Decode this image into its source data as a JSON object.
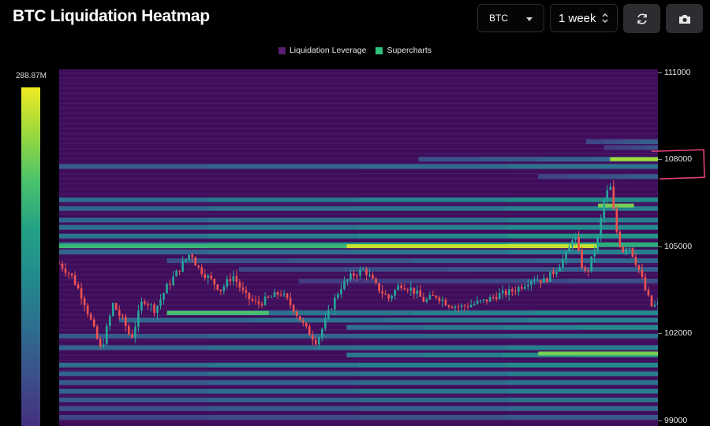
{
  "header": {
    "title": "BTC Liquidation Heatmap",
    "coin_select": "BTC",
    "period_select": "1 week",
    "refresh_icon": "refresh-icon",
    "camera_icon": "camera-icon"
  },
  "legend": [
    {
      "label": "Liquidation Leverage",
      "color": "#5a1e6e"
    },
    {
      "label": "Supercharts",
      "color": "#2ec27e"
    }
  ],
  "colorbar": {
    "max_label": "288.87M"
  },
  "colors": {
    "background": "#000000",
    "heatmap_base": "#3f0d5a",
    "candle_up": "#26a69a",
    "candle_down": "#ef5350",
    "highlight": "#e0407a"
  },
  "chart_data": {
    "type": "heatmap",
    "title": "BTC Liquidation Heatmap",
    "ylim": [
      98800,
      111100
    ],
    "y_ticks": [
      111000,
      108000,
      105000,
      102000,
      99000
    ],
    "x_range": [
      0,
      100
    ],
    "colorscale_max": "288.87M",
    "bands": [
      {
        "price": 108600,
        "x0": 88,
        "intensity": 0.35
      },
      {
        "price": 108400,
        "x0": 91,
        "intensity": 0.3
      },
      {
        "price": 108000,
        "x0": 60,
        "intensity": 0.4
      },
      {
        "price": 107750,
        "x0": 0,
        "intensity": 0.45
      },
      {
        "price": 107400,
        "x0": 80,
        "intensity": 0.35
      },
      {
        "price": 106600,
        "x0": 0,
        "intensity": 0.55
      },
      {
        "price": 106300,
        "x0": 0,
        "intensity": 0.5
      },
      {
        "price": 105900,
        "x0": 0,
        "intensity": 0.5
      },
      {
        "price": 105650,
        "x0": 0,
        "intensity": 0.55
      },
      {
        "price": 105350,
        "x0": 0,
        "intensity": 0.6
      },
      {
        "price": 105050,
        "x0": 0,
        "intensity": 0.7
      },
      {
        "price": 104800,
        "x0": 0,
        "intensity": 0.5
      },
      {
        "price": 104500,
        "x0": 18,
        "intensity": 0.4
      },
      {
        "price": 104200,
        "x0": 30,
        "intensity": 0.35
      },
      {
        "price": 103800,
        "x0": 40,
        "intensity": 0.3
      },
      {
        "price": 102700,
        "x0": 18,
        "intensity": 0.55
      },
      {
        "price": 102450,
        "x0": 10,
        "intensity": 0.5
      },
      {
        "price": 102200,
        "x0": 48,
        "intensity": 0.55
      },
      {
        "price": 101900,
        "x0": 0,
        "intensity": 0.45
      },
      {
        "price": 101500,
        "x0": 0,
        "intensity": 0.5
      },
      {
        "price": 101250,
        "x0": 48,
        "intensity": 0.6
      },
      {
        "price": 100900,
        "x0": 0,
        "intensity": 0.55
      },
      {
        "price": 100600,
        "x0": 0,
        "intensity": 0.5
      },
      {
        "price": 100300,
        "x0": 0,
        "intensity": 0.45
      },
      {
        "price": 100000,
        "x0": 0,
        "intensity": 0.5
      },
      {
        "price": 99700,
        "x0": 0,
        "intensity": 0.45
      },
      {
        "price": 99400,
        "x0": 0,
        "intensity": 0.4
      },
      {
        "price": 99100,
        "x0": 0,
        "intensity": 0.35
      }
    ],
    "hot_bands": [
      {
        "price": 108000,
        "x0": 92,
        "x1": 100,
        "intensity": 0.9
      },
      {
        "price": 105000,
        "x0": 48,
        "x1": 90,
        "intensity": 0.95
      },
      {
        "price": 105000,
        "x0": 0,
        "x1": 48,
        "intensity": 0.75
      },
      {
        "price": 102700,
        "x0": 18,
        "x1": 35,
        "intensity": 0.8
      },
      {
        "price": 101300,
        "x0": 80,
        "x1": 100,
        "intensity": 0.85
      },
      {
        "price": 106400,
        "x0": 90,
        "x1": 96,
        "intensity": 0.85
      }
    ],
    "price_path": [
      [
        0,
        104400
      ],
      [
        2,
        104000
      ],
      [
        4,
        103200
      ],
      [
        6,
        102000
      ],
      [
        7,
        101400
      ],
      [
        9,
        103000
      ],
      [
        11,
        102300
      ],
      [
        12,
        101800
      ],
      [
        14,
        103200
      ],
      [
        16,
        102800
      ],
      [
        18,
        103600
      ],
      [
        20,
        104200
      ],
      [
        22,
        104800
      ],
      [
        23,
        104300
      ],
      [
        25,
        103900
      ],
      [
        27,
        103500
      ],
      [
        29,
        104000
      ],
      [
        31,
        103300
      ],
      [
        33,
        103000
      ],
      [
        35,
        103200
      ],
      [
        37,
        103400
      ],
      [
        39,
        102900
      ],
      [
        41,
        102200
      ],
      [
        43,
        101700
      ],
      [
        45,
        102700
      ],
      [
        47,
        103600
      ],
      [
        49,
        104000
      ],
      [
        51,
        104200
      ],
      [
        53,
        103600
      ],
      [
        55,
        103200
      ],
      [
        57,
        103700
      ],
      [
        59,
        103500
      ],
      [
        61,
        103100
      ],
      [
        63,
        103300
      ],
      [
        65,
        103000
      ],
      [
        67,
        102900
      ],
      [
        69,
        103000
      ],
      [
        71,
        103100
      ],
      [
        73,
        103300
      ],
      [
        75,
        103400
      ],
      [
        77,
        103600
      ],
      [
        79,
        103900
      ],
      [
        81,
        103800
      ],
      [
        83,
        104200
      ],
      [
        85,
        104800
      ],
      [
        86,
        105500
      ],
      [
        87,
        104500
      ],
      [
        88,
        104000
      ],
      [
        89,
        104600
      ],
      [
        90,
        105300
      ],
      [
        91,
        106600
      ],
      [
        92,
        107100
      ],
      [
        93,
        105600
      ],
      [
        94,
        104800
      ],
      [
        95,
        105100
      ],
      [
        96,
        104600
      ],
      [
        97,
        104100
      ],
      [
        98,
        103400
      ],
      [
        99,
        102900
      ],
      [
        100,
        103000
      ]
    ],
    "annotation": {
      "type": "highlight-box",
      "price": 108000
    }
  }
}
